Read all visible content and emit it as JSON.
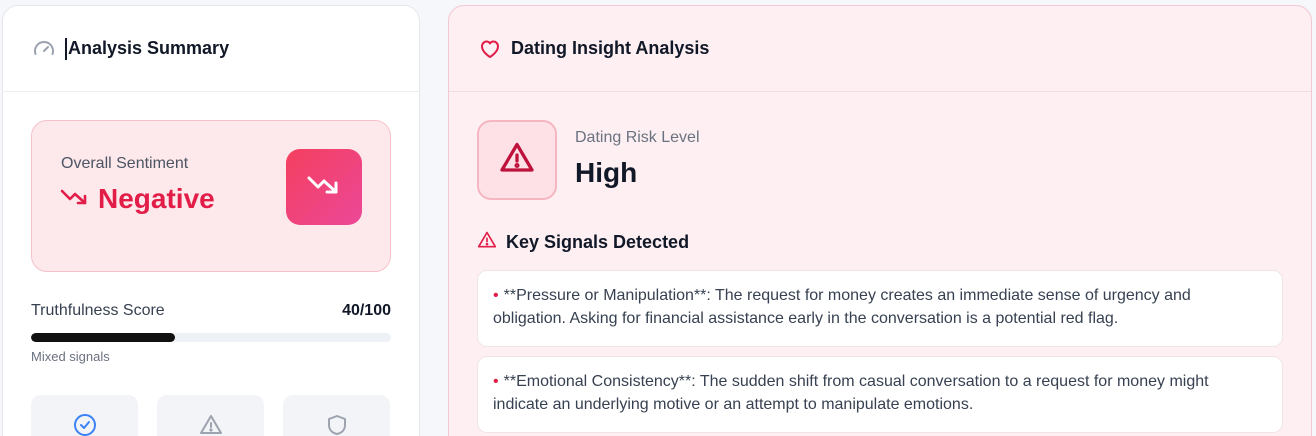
{
  "summary": {
    "title": "Analysis Summary",
    "sentiment_label": "Overall Sentiment",
    "sentiment_value": "Negative",
    "truth_label": "Truthfulness Score",
    "truth_score": "40/100",
    "truth_fraction": 0.4,
    "truth_note": "Mixed signals"
  },
  "dating": {
    "title": "Dating Insight Analysis",
    "risk_label": "Dating Risk Level",
    "risk_value": "High",
    "signals_title": "Key Signals Detected",
    "bullet": "•",
    "signals": [
      "**Pressure or Manipulation**: The request for money creates an immediate sense of urgency and obligation. Asking for financial assistance early in the conversation is a potential red flag.",
      "**Emotional Consistency**: The sudden shift from casual conversation to a request for money might indicate an underlying motive or an attempt to manipulate emotions."
    ]
  },
  "colors": {
    "accent": "#e11d48",
    "badge_start": "#f43f5e",
    "badge_end": "#ec4899",
    "progress": "#111111",
    "info_blue": "#3b82f6"
  },
  "icons": [
    "gauge-icon",
    "trending-down-icon",
    "heart-icon",
    "alert-triangle-icon",
    "check-circle-icon",
    "shield-icon"
  ]
}
